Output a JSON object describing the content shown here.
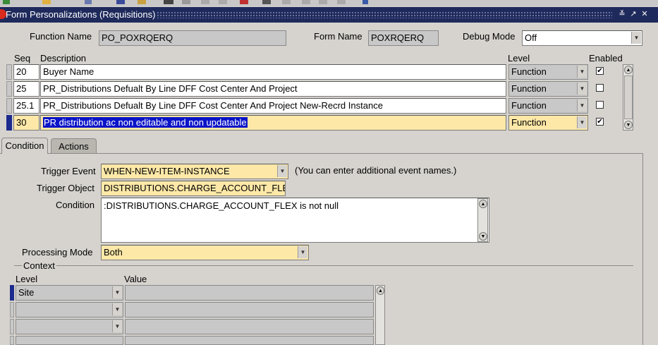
{
  "window": {
    "title": "Form Personalizations (Requisitions)"
  },
  "header": {
    "function_name_label": "Function Name",
    "function_name_value": "PO_POXRQERQ",
    "form_name_label": "Form Name",
    "form_name_value": "POXRQERQ",
    "debug_mode_label": "Debug Mode",
    "debug_mode_value": "Off"
  },
  "grid": {
    "columns": {
      "seq": "Seq",
      "description": "Description",
      "level": "Level",
      "enabled": "Enabled"
    },
    "rows": [
      {
        "seq": "20",
        "description": "Buyer Name",
        "level": "Function",
        "enabled": true,
        "current": false
      },
      {
        "seq": "25",
        "description": "PR_Distributions Defualt By Line DFF Cost Center And Project",
        "level": "Function",
        "enabled": false,
        "current": false
      },
      {
        "seq": "25.1",
        "description": "PR_Distributions Defualt By Line DFF Cost Center And Project New-Recrd Instance",
        "level": "Function",
        "enabled": false,
        "current": false
      },
      {
        "seq": "30",
        "description": "PR distribution ac non editable and non updatable",
        "level": "Function",
        "enabled": true,
        "current": true
      }
    ]
  },
  "tabs": {
    "condition": "Condition",
    "actions": "Actions"
  },
  "condition": {
    "trigger_event_label": "Trigger Event",
    "trigger_event_value": "WHEN-NEW-ITEM-INSTANCE",
    "trigger_event_hint": "(You can enter additional event names.)",
    "trigger_object_label": "Trigger Object",
    "trigger_object_value": "DISTRIBUTIONS.CHARGE_ACCOUNT_FLEX",
    "condition_label": "Condition",
    "condition_value": ":DISTRIBUTIONS.CHARGE_ACCOUNT_FLEX is not null",
    "processing_mode_label": "Processing Mode",
    "processing_mode_value": "Both"
  },
  "context": {
    "section_label": "Context",
    "level_header": "Level",
    "value_header": "Value",
    "rows": [
      {
        "level": "Site",
        "value": ""
      },
      {
        "level": "",
        "value": ""
      },
      {
        "level": "",
        "value": ""
      },
      {
        "level": "",
        "value": ""
      }
    ]
  },
  "icons": {
    "check": "✔",
    "arrow_down": "▼",
    "arrow_up": "▲",
    "minimize": "≚",
    "restore": "↗",
    "close": "✕"
  }
}
